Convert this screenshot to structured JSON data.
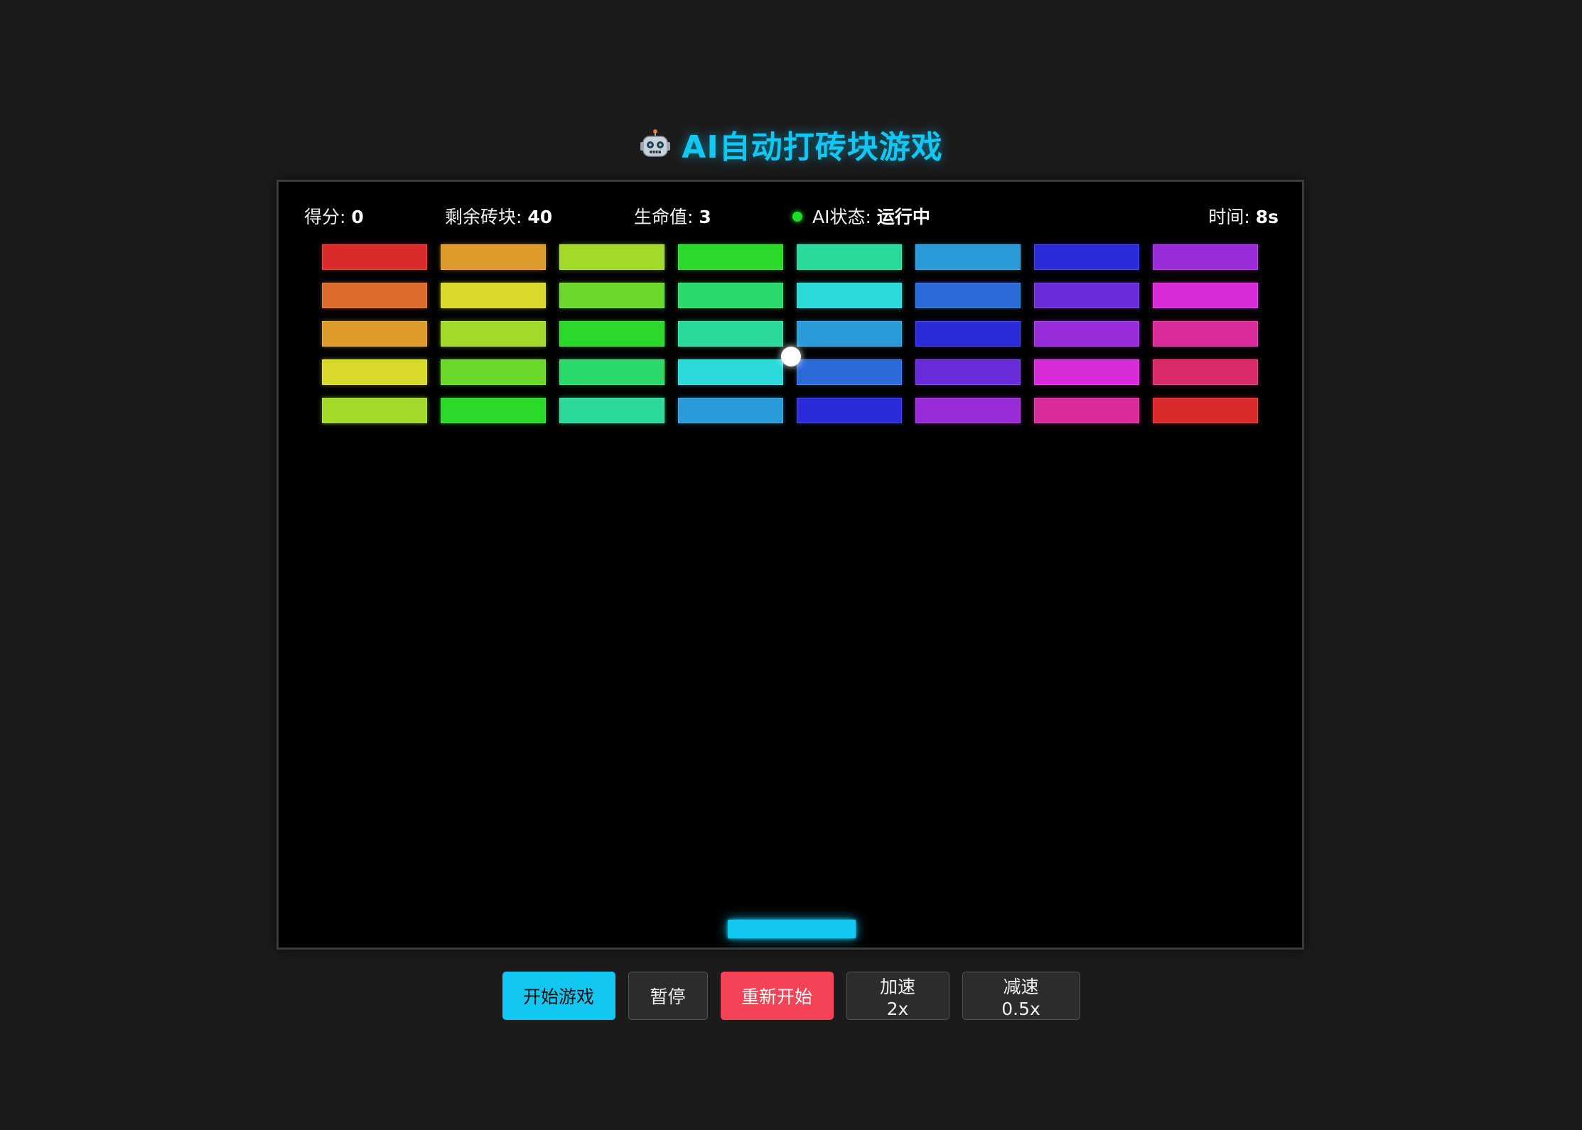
{
  "header": {
    "title": "AI自动打砖块游戏",
    "icon": "robot-icon"
  },
  "hud": {
    "score_label": "得分:",
    "score_value": "0",
    "bricks_label": "剩余砖块:",
    "bricks_value": "40",
    "lives_label": "生命值:",
    "lives_value": "3",
    "ai_label": "AI状态:",
    "ai_value": "运行中",
    "ai_status_color": "#1fdc2a",
    "time_label": "时间:",
    "time_value": "8s"
  },
  "bricks": {
    "rows": [
      [
        "#d92b2b",
        "#dc9a2a",
        "#a3d92b",
        "#2bd92b",
        "#2bd99a",
        "#2b9ad9",
        "#2b2bd9",
        "#9a2bd9"
      ],
      [
        "#dc6a2b",
        "#d9d92b",
        "#6ad92b",
        "#2bd96a",
        "#2bd9d9",
        "#2b6ad9",
        "#6a2bd9",
        "#d92bd9"
      ],
      [
        "#dc9a2a",
        "#a3d92b",
        "#2bd92b",
        "#2bd99a",
        "#2b9ad9",
        "#2b2bd9",
        "#9a2bd9",
        "#d92b9a"
      ],
      [
        "#d9d92b",
        "#6ad92b",
        "#2bd96a",
        "#2bd9d9",
        "#2b6ad9",
        "#6a2bd9",
        "#d92bd9",
        "#d92b6a"
      ],
      [
        "#a3d92b",
        "#2bd92b",
        "#2bd99a",
        "#2b9ad9",
        "#2b2bd9",
        "#9a2bd9",
        "#d92b9a",
        "#d92b2b"
      ]
    ]
  },
  "game": {
    "ball_color": "#ffffff",
    "paddle_color": "#12c8f2"
  },
  "controls": {
    "start_label": "开始游戏",
    "pause_label": "暂停",
    "restart_label": "重新开始",
    "speedup_label": "加速 2x",
    "slowdown_label": "减速 0.5x"
  }
}
